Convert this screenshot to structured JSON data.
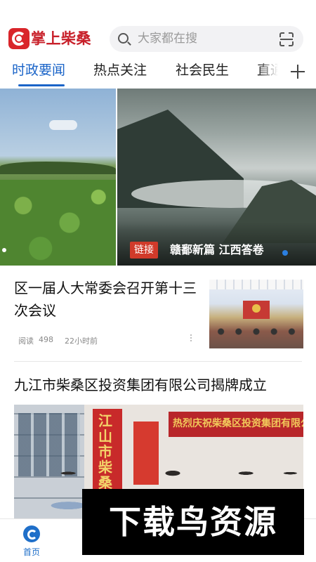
{
  "app": {
    "name": "掌上柴桑"
  },
  "search": {
    "placeholder": "大家都在搜"
  },
  "tabs": [
    {
      "label": "时政要闻",
      "active": true
    },
    {
      "label": "热点关注",
      "active": false
    },
    {
      "label": "社会民生",
      "active": false
    },
    {
      "label": "直通",
      "active": false
    }
  ],
  "banner": {
    "tag": "链接",
    "caption": "赣鄱新篇 江西答卷"
  },
  "news": [
    {
      "title": "区一届人大常委会召开第十三次会议",
      "reads_label": "阅读",
      "reads": "498",
      "time": "22小时前"
    },
    {
      "title": "九江市柴桑区投资集团有限公司揭牌成立",
      "image_text_vertical": "江山市柴桑区投资",
      "image_text_banner": "热烈庆祝柴桑区投资集团有限公司"
    }
  ],
  "bottom_nav": [
    {
      "label": "首页",
      "active": true
    },
    {
      "label": "",
      "active": false
    },
    {
      "label": "",
      "active": false
    },
    {
      "label": "",
      "active": false
    },
    {
      "label": "",
      "active": false
    }
  ],
  "watermark": {
    "text": "下载鸟资源"
  },
  "colors": {
    "accent": "#1a64c8",
    "brand": "#d9252a",
    "tag": "#d03a2a"
  },
  "icons": [
    "app-logo-icon",
    "search-icon",
    "scan-icon",
    "plus-icon",
    "more-icon",
    "home-icon"
  ]
}
